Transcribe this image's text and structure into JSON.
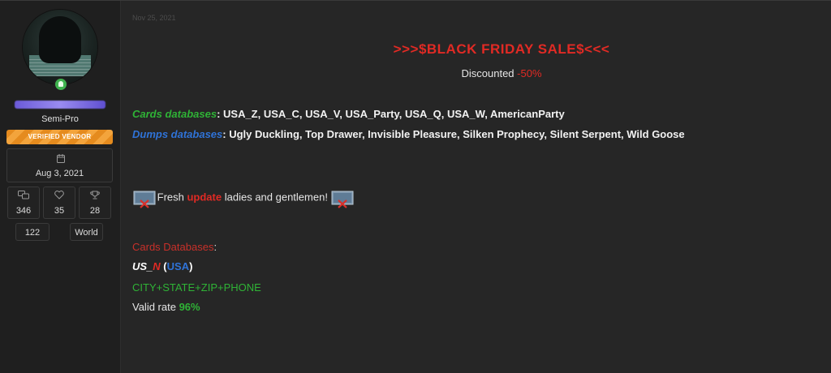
{
  "sidebar": {
    "user_title": "Semi-Pro",
    "banner": "VERIFIED VENDOR",
    "joined_date": "Aug 3, 2021",
    "stats": [
      {
        "icon": "messages-icon",
        "value": "346"
      },
      {
        "icon": "heart-icon",
        "value": "35"
      },
      {
        "icon": "trophy-icon",
        "value": "28"
      }
    ],
    "mini": [
      "122",
      "World"
    ]
  },
  "post": {
    "date": "Nov 25, 2021",
    "headline": ">>>$BLACK FRIDAY SALE$<<<",
    "discount_label": "Discounted",
    "discount_value": "-50%",
    "cards_label": "Cards databases",
    "cards_list": ": USA_Z, USA_C, USA_V, USA_Party, USA_Q, USA_W, AmericanParty",
    "dumps_label": "Dumps databases",
    "dumps_list": ": Ugly Duckling, Top Drawer, Invisible Pleasure, Silken Prophecy, Silent Serpent, Wild Goose",
    "update_pre": "Fresh",
    "update_word": "update",
    "update_post": "ladies and gentlemen!",
    "cards_db_heading": "Cards Databases",
    "cards_db_colon": ":",
    "usn_us": "US_",
    "usn_n": "N",
    "usn_open": " (",
    "usn_usa": "USA",
    "usn_close": ")",
    "fields": "CITY+STATE+ZIP+PHONE",
    "valid_label": "Valid rate ",
    "valid_value": "96%"
  },
  "colors": {
    "red": "#e12a24",
    "green": "#2fb336",
    "blue": "#2f73d8",
    "banner": "#e58b1e"
  }
}
